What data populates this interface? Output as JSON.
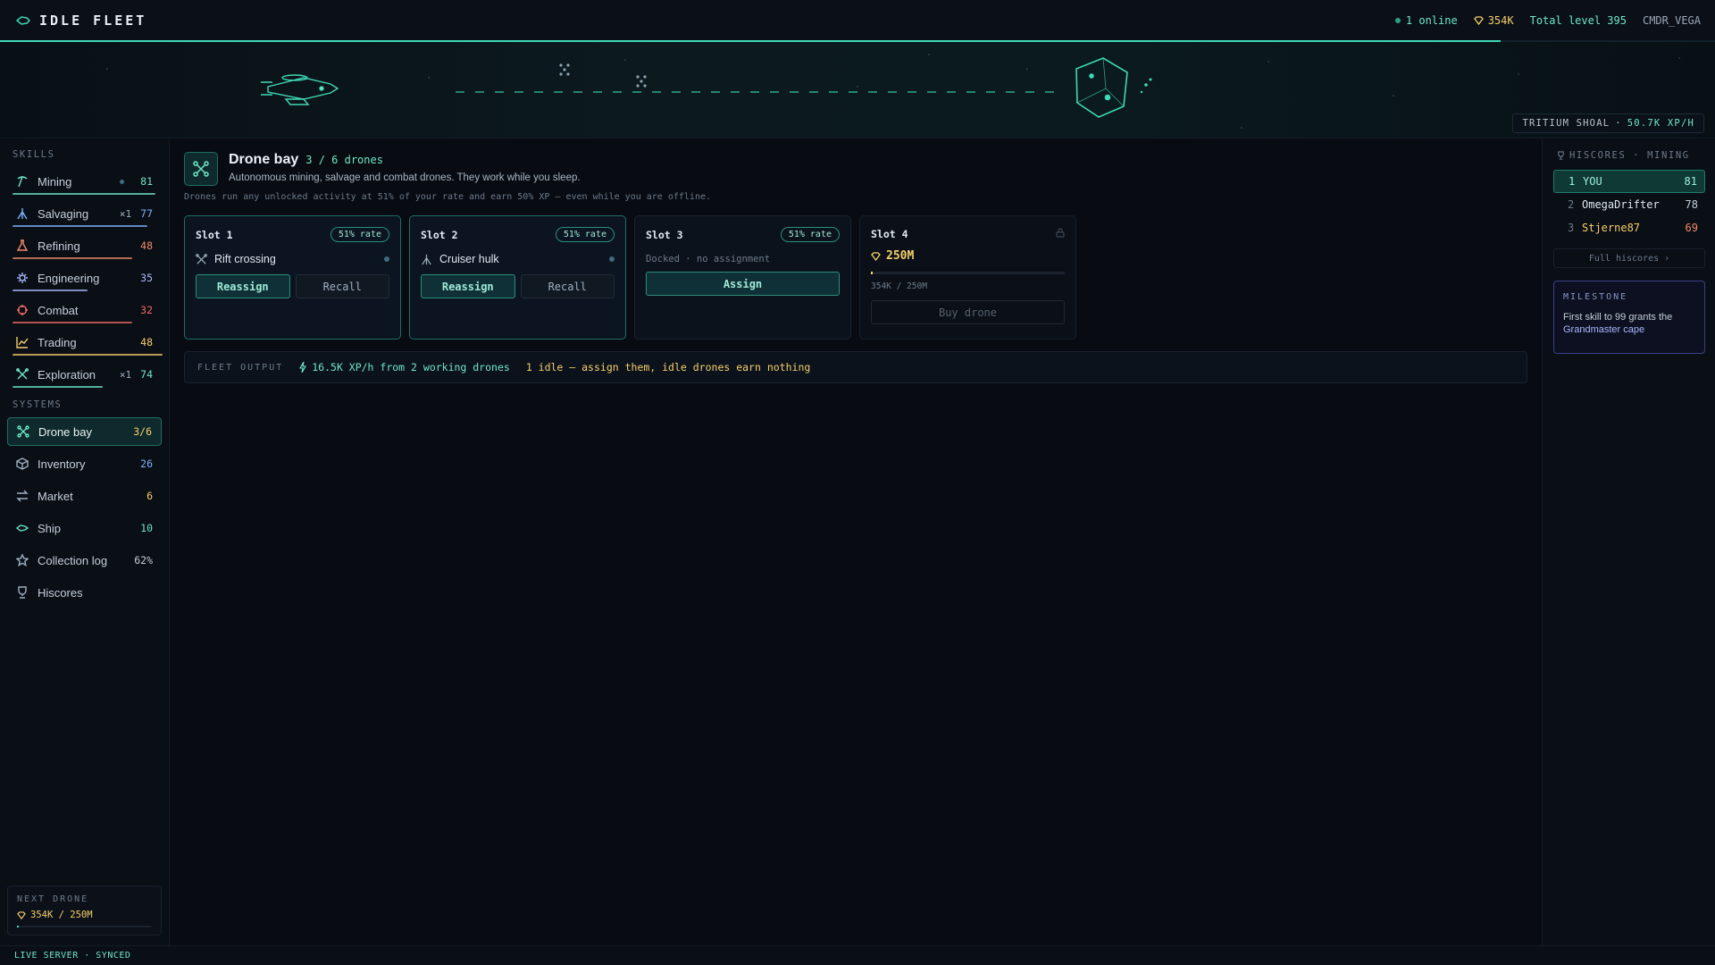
{
  "app": {
    "title": "IDLE FLEET"
  },
  "topbar": {
    "online": "1 online",
    "credits": "354K",
    "total_level": "Total level 395",
    "username": "CMDR_VEGA",
    "level_progress": 0.875
  },
  "scene": {
    "zone": "TRITIUM SHOAL",
    "separator": "·",
    "rate": "50.7K XP/H"
  },
  "sidebar": {
    "skills_title": "SKILLS",
    "skills": [
      {
        "label": "Mining",
        "value": "81",
        "extra": "",
        "has_dot": true,
        "color": "#6ee7c8",
        "icon": "pickaxe-icon",
        "progress": 0.95
      },
      {
        "label": "Salvaging",
        "value": "77",
        "extra": "⨯1",
        "has_dot": false,
        "color": "#7fb2ff",
        "icon": "salvage-icon",
        "progress": 0.9
      },
      {
        "label": "Refining",
        "value": "48",
        "extra": "",
        "has_dot": false,
        "color": "#f08a6a",
        "icon": "flask-icon",
        "progress": 0.8
      },
      {
        "label": "Engineering",
        "value": "35",
        "extra": "",
        "has_dot": false,
        "color": "#a9b8ff",
        "icon": "gear-icon",
        "progress": 0.5
      },
      {
        "label": "Combat",
        "value": "32",
        "extra": "",
        "has_dot": false,
        "color": "#f06a6a",
        "icon": "crosshair-icon",
        "progress": 0.8
      },
      {
        "label": "Trading",
        "value": "48",
        "extra": "",
        "has_dot": false,
        "color": "#f5cf6b",
        "icon": "chart-icon",
        "progress": 1.0
      },
      {
        "label": "Exploration",
        "value": "74",
        "extra": "⨯1",
        "has_dot": false,
        "color": "#6ee7c8",
        "icon": "compass-icon",
        "progress": 0.6
      }
    ],
    "systems_title": "SYSTEMS",
    "systems": [
      {
        "label": "Drone bay",
        "value": "3/6",
        "color": "#f5cf6b",
        "icon": "drone-icon",
        "active": true
      },
      {
        "label": "Inventory",
        "value": "26",
        "color": "#7fb2ff",
        "icon": "box-icon",
        "active": false
      },
      {
        "label": "Market",
        "value": "6",
        "color": "#f5cf6b",
        "icon": "swap-icon",
        "active": false
      },
      {
        "label": "Ship",
        "value": "10",
        "color": "#6ee7c8",
        "icon": "ship-icon",
        "active": false
      },
      {
        "label": "Collection log",
        "value": "62%",
        "color": "#c5cfda",
        "icon": "star-icon",
        "active": false
      },
      {
        "label": "Hiscores",
        "value": "",
        "color": "#c5cfda",
        "icon": "trophy-icon",
        "active": false
      }
    ],
    "next_drone": {
      "title": "NEXT DRONE",
      "value": "354K / 250M",
      "progress": 0.0014
    }
  },
  "main": {
    "title": "Drone bay",
    "count": "3 / 6 drones",
    "description": "Autonomous mining, salvage and combat drones. They work while you sleep.",
    "note": "Drones run any unlocked activity at 51% of your rate and earn 50% XP — even while you are offline.",
    "slots": [
      {
        "name": "Slot 1",
        "rate": "51% rate",
        "task": "Rift crossing",
        "task_icon": "compass-icon",
        "btn_reassign": "Reassign",
        "btn_recall": "Recall"
      },
      {
        "name": "Slot 2",
        "rate": "51% rate",
        "task": "Cruiser hulk",
        "task_icon": "salvage-icon",
        "btn_reassign": "Reassign",
        "btn_recall": "Recall"
      },
      {
        "name": "Slot 3",
        "rate": "51% rate",
        "idle_text": "Docked · no assignment",
        "btn_assign": "Assign"
      },
      {
        "name": "Slot 4",
        "price": "250M",
        "progress_text": "354K / 250M",
        "progress": 0.0014,
        "btn_buy": "Buy drone"
      }
    ],
    "fleet_output": {
      "label": "FLEET OUTPUT",
      "xp": "16.5K XP/h from 2 working drones",
      "warning": "1 idle — assign them, idle drones earn nothing"
    }
  },
  "hiscores": {
    "title": "HISCORES · MINING",
    "rows": [
      {
        "rank": "1",
        "name": "YOU",
        "score": "81",
        "me": true,
        "score_color": "#9ff0db"
      },
      {
        "rank": "2",
        "name": "OmegaDrifter",
        "score": "78",
        "me": false,
        "score_color": "#c5cfda"
      },
      {
        "rank": "3",
        "name": "Stjerne87",
        "score": "69",
        "me": false,
        "score_color": "#f08a6a"
      }
    ],
    "full_link": "Full hiscores ›"
  },
  "milestone": {
    "title": "MILESTONE",
    "text": "First skill to 99 grants the",
    "highlight": "Grandmaster cape"
  },
  "footer": {
    "status": "LIVE SERVER · SYNCED"
  }
}
